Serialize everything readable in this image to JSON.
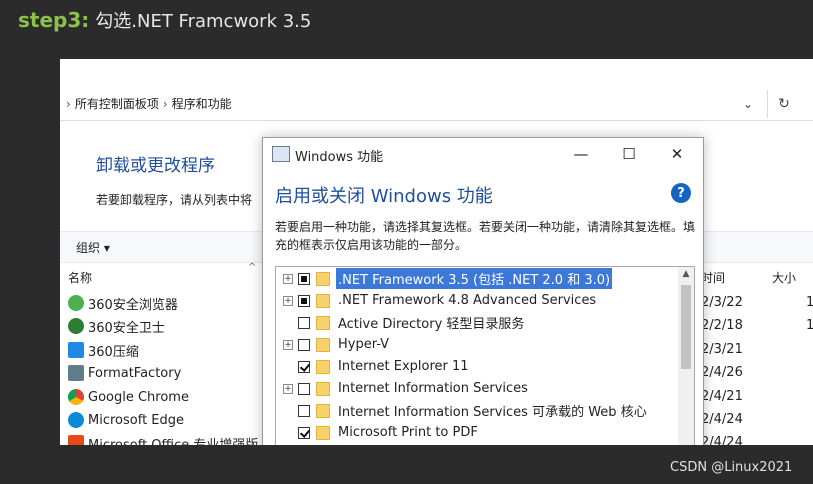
{
  "caption": {
    "step": "step3:",
    "text": "勾选.NET Framcwork 3.5"
  },
  "address_bar": {
    "crumbs": [
      "所有控制面板项",
      "程序和功能"
    ],
    "separator": "›",
    "dropdown_icon": "chevron-down-icon",
    "refresh_icon": "refresh-icon"
  },
  "control_panel": {
    "title": "卸载或更改程序",
    "description": "若要卸载程序，请从列表中将",
    "organize_label": "组织 ▾",
    "columns": {
      "name": "名称",
      "date": "时间",
      "size": "大小"
    },
    "programs": [
      {
        "name": "360安全浏览器",
        "date": "2/3/22",
        "size": "1",
        "color": "#4caf50"
      },
      {
        "name": "360安全卫士",
        "date": "2/2/18",
        "size": "1",
        "color": "#2e7d32"
      },
      {
        "name": "360压缩",
        "date": "2/3/21",
        "size": "",
        "color": "#1e88e5"
      },
      {
        "name": "FormatFactory",
        "date": "2/4/26",
        "size": "",
        "color": "#607d8b"
      },
      {
        "name": "Google Chrome",
        "date": "2/4/21",
        "size": "",
        "color": "#f4b400"
      },
      {
        "name": "Microsoft Edge",
        "date": "2/4/24",
        "size": "",
        "color": "#0b8ad6"
      },
      {
        "name": "Microsoft Office 专业增强版",
        "date": "2/4/24",
        "size": "",
        "color": "#e64a19"
      }
    ]
  },
  "dialog": {
    "title": "Windows 功能",
    "heading": "启用或关闭 Windows 功能",
    "help_icon": "?",
    "description": "若要启用一种功能，请选择其复选框。若要关闭一种功能，请清除其复选框。填充的框表示仅启用该功能的一部分。",
    "controls": {
      "minimize": "—",
      "maximize": "☐",
      "close": "✕"
    },
    "features": [
      {
        "label": ".NET Framework 3.5 (包括 .NET 2.0 和 3.0)",
        "state": "partial",
        "expandable": true,
        "selected": true
      },
      {
        "label": ".NET Framework 4.8 Advanced Services",
        "state": "partial",
        "expandable": true,
        "selected": false
      },
      {
        "label": "Active Directory 轻型目录服务",
        "state": "unchecked",
        "expandable": false,
        "selected": false
      },
      {
        "label": "Hyper-V",
        "state": "unchecked",
        "expandable": true,
        "selected": false
      },
      {
        "label": "Internet Explorer 11",
        "state": "checked",
        "expandable": false,
        "selected": false
      },
      {
        "label": "Internet Information Services",
        "state": "unchecked",
        "expandable": true,
        "selected": false
      },
      {
        "label": "Internet Information Services 可承载的 Web 核心",
        "state": "unchecked",
        "expandable": false,
        "selected": false
      },
      {
        "label": "Microsoft Print to PDF",
        "state": "checked",
        "expandable": false,
        "selected": false
      }
    ]
  },
  "watermark": "CSDN @Linux2021"
}
